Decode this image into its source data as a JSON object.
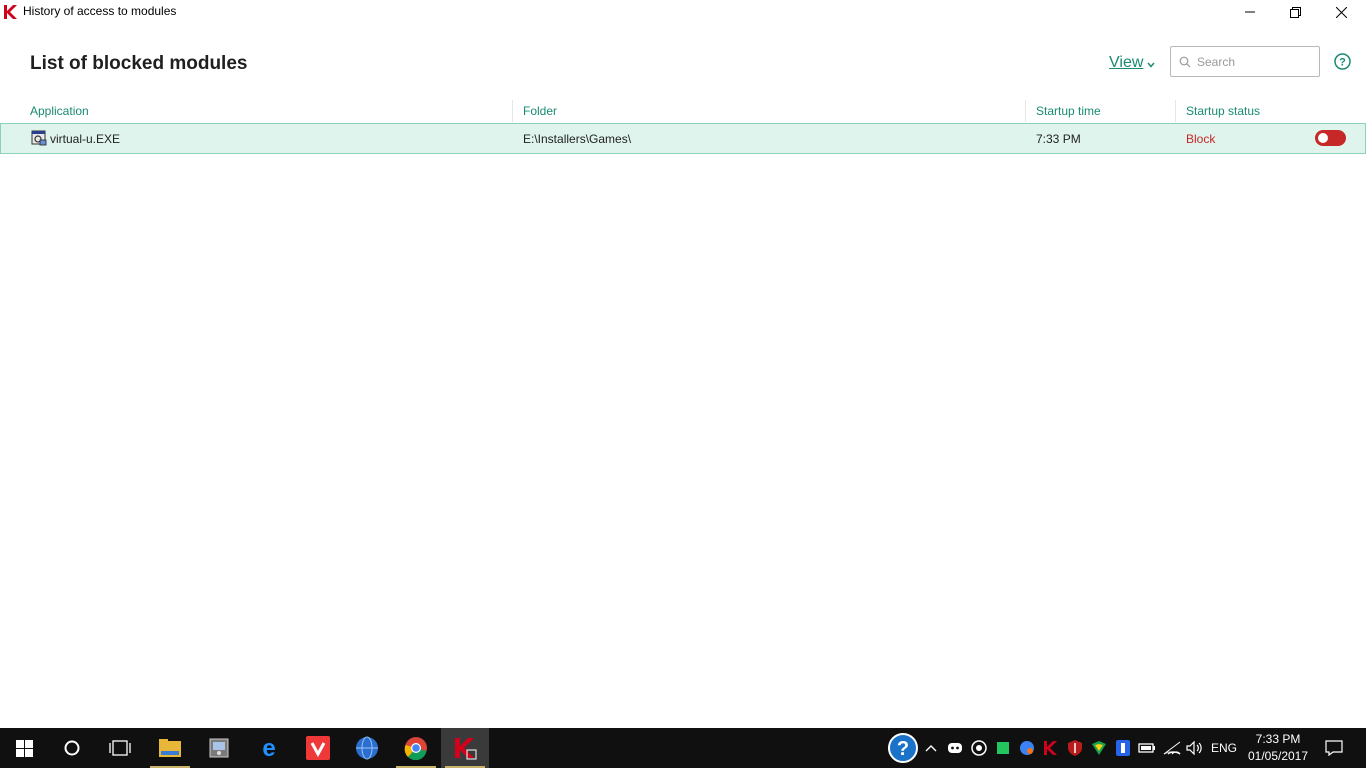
{
  "window": {
    "title": "History of access to modules",
    "accent": "#1a8a72",
    "block_color": "#c62828"
  },
  "header": {
    "page_title": "List of blocked modules",
    "view_label": "View",
    "search_placeholder": "Search"
  },
  "table": {
    "columns": [
      "Application",
      "Folder",
      "Startup time",
      "Startup status"
    ],
    "rows": [
      {
        "application": "virtual-u.EXE",
        "folder": "E:\\Installers\\Games\\",
        "startup_time": "7:33 PM",
        "startup_status": "Block",
        "toggle_on": false
      }
    ]
  },
  "taskbar": {
    "apps": [
      "windows-start",
      "cortana",
      "task-view",
      "file-explorer",
      "app-generic",
      "edge",
      "vivaldi",
      "globe-browser",
      "chrome",
      "kaspersky"
    ],
    "tray_language": "ENG",
    "clock_time": "7:33 PM",
    "clock_date": "01/05/2017"
  }
}
